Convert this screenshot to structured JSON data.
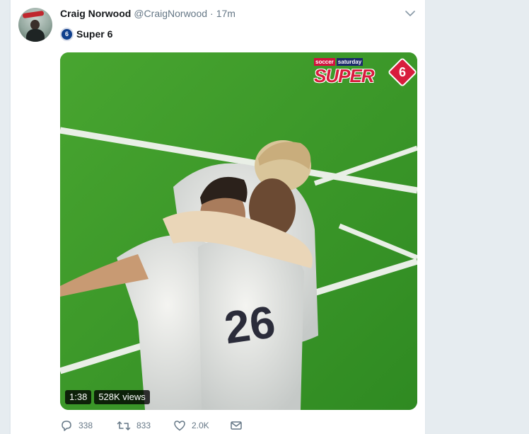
{
  "tweet": {
    "author_name": "Craig Norwood",
    "author_handle": "@CraigNorwood",
    "separator": "·",
    "time": "17m",
    "text": "Super 6",
    "text_icon": "super6-logo-icon",
    "more_icon": "chevron-down-icon"
  },
  "video": {
    "logo_top_left": "soccer",
    "logo_top_right": "saturday",
    "logo_main": "SUPER",
    "logo_number": "6",
    "duration": "1:38",
    "views": "528K views",
    "shirt_number": "26"
  },
  "actions": {
    "reply_count": "338",
    "retweet_count": "833",
    "like_count": "2.0K"
  },
  "colors": {
    "name": "#14171a",
    "meta": "#657786",
    "pitch": "#3f9a29",
    "logo_red": "#d81c3d",
    "page_bg": "#e6ecf0"
  }
}
